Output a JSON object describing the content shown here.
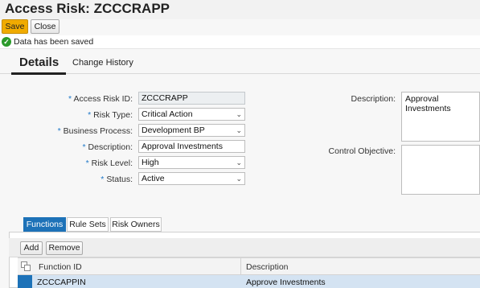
{
  "header": {
    "title": "Access Risk: ZCCCRAPP"
  },
  "toolbar": {
    "save_label": "Save",
    "close_label": "Close"
  },
  "message": {
    "text": "Data has been saved",
    "icon": "success-check-icon"
  },
  "tabs": {
    "details": "Details",
    "change_history": "Change History"
  },
  "form": {
    "access_risk_id": {
      "label": "Access Risk ID:",
      "value": "ZCCCRAPP"
    },
    "risk_type": {
      "label": "Risk Type:",
      "value": "Critical Action"
    },
    "business_process": {
      "label": "Business Process:",
      "value": "Development BP"
    },
    "description": {
      "label": "Description:",
      "value": "Approval Investments"
    },
    "risk_level": {
      "label": "Risk Level:",
      "value": "High"
    },
    "status": {
      "label": "Status:",
      "value": "Active"
    },
    "required_marker": "*"
  },
  "right_panel": {
    "description_label": "Description:",
    "description_value": "Approval Investments",
    "control_objective_label": "Control Objective:",
    "control_objective_value": ""
  },
  "sub_tabs": [
    "Functions",
    "Rule Sets",
    "Risk Owners"
  ],
  "functions": {
    "add_label": "Add",
    "remove_label": "Remove",
    "columns": [
      "Function ID",
      "Description"
    ],
    "rows": [
      {
        "function_id": "ZCCCAPPIN",
        "description": "Approve Investments"
      }
    ]
  },
  "colors": {
    "save_button": "#f0ab00",
    "active_tab": "#1d72b8",
    "selected_row": "#d4e3f2",
    "success": "#2b9a2b",
    "required": "#1f78c8"
  }
}
